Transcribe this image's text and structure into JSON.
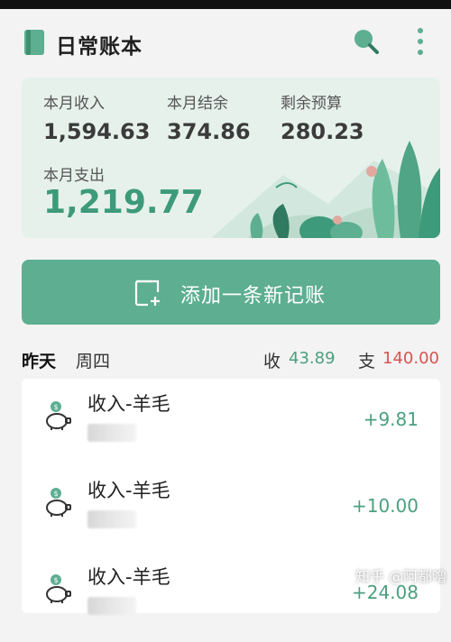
{
  "app": {
    "title": "日常账本",
    "icons": {
      "app": "ledger-book-icon",
      "search": "search-icon",
      "more": "more-vertical-icon"
    }
  },
  "summary": {
    "month_income_label": "本月收入",
    "month_income": "1,594.63",
    "month_balance_label": "本月结余",
    "month_balance": "374.86",
    "remaining_budget_label": "剩余预算",
    "remaining_budget": "280.23",
    "month_expense_label": "本月支出",
    "month_expense": "1,219.77"
  },
  "add_button": {
    "label": "添加一条新记账",
    "icon": "add-record-icon"
  },
  "day": {
    "name": "昨天",
    "weekday": "周四",
    "income_label": "收",
    "income_value": "43.89",
    "expense_label": "支",
    "expense_value": "140.00"
  },
  "entries": [
    {
      "title": "收入-羊毛",
      "amount": "+9.81",
      "icon": "piggy-bank-icon"
    },
    {
      "title": "收入-羊毛",
      "amount": "+10.00",
      "icon": "piggy-bank-icon"
    },
    {
      "title": "收入-羊毛",
      "amount": "+24.08",
      "icon": "piggy-bank-icon"
    }
  ],
  "watermark": "知乎 @阿都噜",
  "colors": {
    "accent": "#5eae92",
    "income": "#4aa07f",
    "expense": "#d9534f"
  }
}
